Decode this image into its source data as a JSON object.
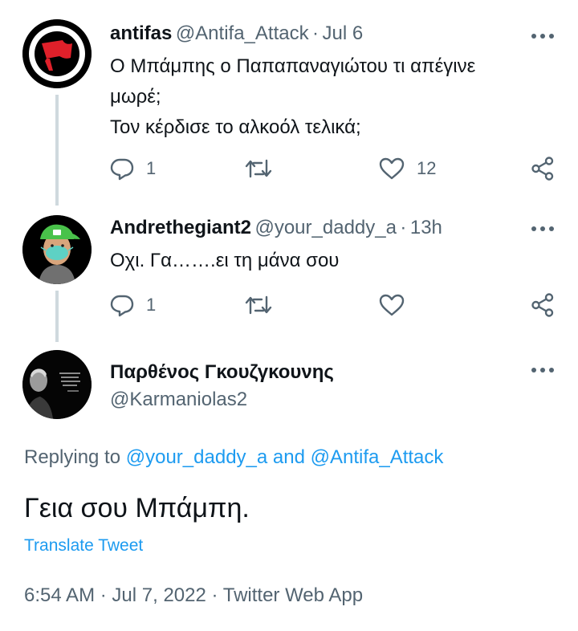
{
  "tweets": [
    {
      "name": "antifas",
      "handle": "@Antifa_Attack",
      "sep": "·",
      "time": "Jul 6",
      "lines": [
        "Ο Μπάμπης ο Παπαπαναγιώτου τι απέγινε",
        "μωρέ;",
        "Τον κέρδισε το αλκοόλ τελικά;"
      ],
      "replies": "1",
      "likes": "12",
      "avatar_icon": "antifa-flag-logo"
    },
    {
      "name": "Andrethegiant2",
      "handle": "@your_daddy_a",
      "sep": "·",
      "time": "13h",
      "lines": [
        "Οχι. Γα…….ει τη μάνα σου"
      ],
      "replies": "1",
      "likes": "",
      "avatar_icon": "bitmoji-avatar"
    }
  ],
  "main": {
    "name": "Παρθένος Γκουζγκουνης",
    "handle": "@Karmaniolas2",
    "replying_prefix": "Replying to",
    "replying_user1": "@your_daddy_a",
    "replying_and": "and",
    "replying_user2": "@Antifa_Attack",
    "text": "Γεια σου Μπάμπη.",
    "translate": "Translate Tweet",
    "meta_time": "6:54 AM",
    "meta_date": "Jul 7, 2022",
    "meta_source": "Twitter Web App",
    "meta_sep": "·"
  },
  "colors": {
    "link": "#1d9bf0",
    "secondary_text": "#536471",
    "thread_line": "#cfd9de",
    "logo_red": "#e0202a"
  }
}
